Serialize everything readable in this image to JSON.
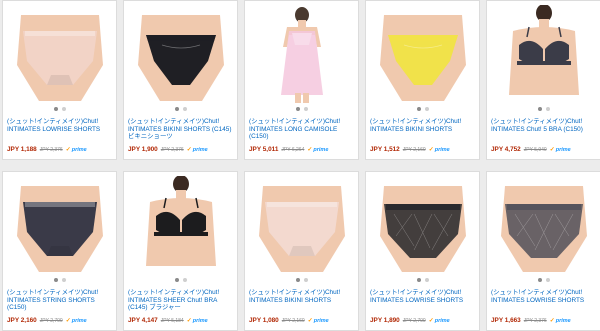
{
  "colors": {
    "link": "#0066c0",
    "price": "#b12704",
    "prime": "#1a98ff",
    "prime_check": "#ff9900"
  },
  "products": [
    {
      "title": "(シュット!インティメイツ)Chut! INTIMATES LOWRISE SHORTS",
      "price": "JPY 1,188",
      "list_price": "JPY 2,376",
      "prime": "prime",
      "product_color": "#f2d3c6",
      "type": "shorts"
    },
    {
      "title": "(シュット!インティメイツ)Chut! INTIMATES BIKINI SHORTS (C145) ビキニショーツ",
      "price": "JPY 1,900",
      "list_price": "JPY 2,376",
      "prime": "prime",
      "product_color": "#1f1f24",
      "type": "bikini"
    },
    {
      "title": "(シュット!インティメイツ)Chut! INTIMATES LONG CAMISOLE (C150)",
      "price": "JPY 5,011",
      "list_price": "JPY 6,264",
      "prime": "prime",
      "product_color": "#f4c7dd",
      "type": "camisole"
    },
    {
      "title": "(シュット!インティメイツ)Chut! INTIMATES BIKINI SHORTS",
      "price": "JPY 1,512",
      "list_price": "JPY 2,160",
      "prime": "prime",
      "product_color": "#f1e24a",
      "type": "bikini"
    },
    {
      "title": "(シュット!インティメイツ)Chut! INTIMATES Chut! 5 BRA (C150)",
      "price": "JPY 4,752",
      "list_price": "JPY 5,940",
      "prime": "prime",
      "product_color": "#3b3c48",
      "type": "bra-model"
    },
    {
      "title": "(シュット!インティメイツ)Chut! INTIMATES STRING SHORTS (C150)",
      "price": "JPY 2,160",
      "list_price": "JPY 2,700",
      "prime": "prime",
      "product_color": "#3a3a48",
      "type": "shorts"
    },
    {
      "title": "(シュット!インティメイツ)Chut! INTIMATES SHEER Chut! BRA (C145) ブラジャー",
      "price": "JPY 4,147",
      "list_price": "JPY 5,184",
      "prime": "prime",
      "product_color": "#1c1c1e",
      "type": "bra-model"
    },
    {
      "title": "(シュット!インティメイツ)Chut! INTIMATES BIKINI SHORTS",
      "price": "JPY 1,080",
      "list_price": "JPY 2,160",
      "prime": "prime",
      "product_color": "#f3d9cf",
      "type": "shorts"
    },
    {
      "title": "(シュット!インティメイツ)Chut! INTIMATES LOWRISE SHORTS",
      "price": "JPY 1,890",
      "list_price": "JPY 2,700",
      "prime": "prime",
      "product_color": "#2a2a2e",
      "type": "lace"
    },
    {
      "title": "(シュット!インティメイツ)Chut! INTIMATES LOWRISE SHORTS",
      "price": "JPY 1,663",
      "list_price": "JPY 2,376",
      "prime": "prime",
      "product_color": "#55535c",
      "type": "lace"
    }
  ]
}
